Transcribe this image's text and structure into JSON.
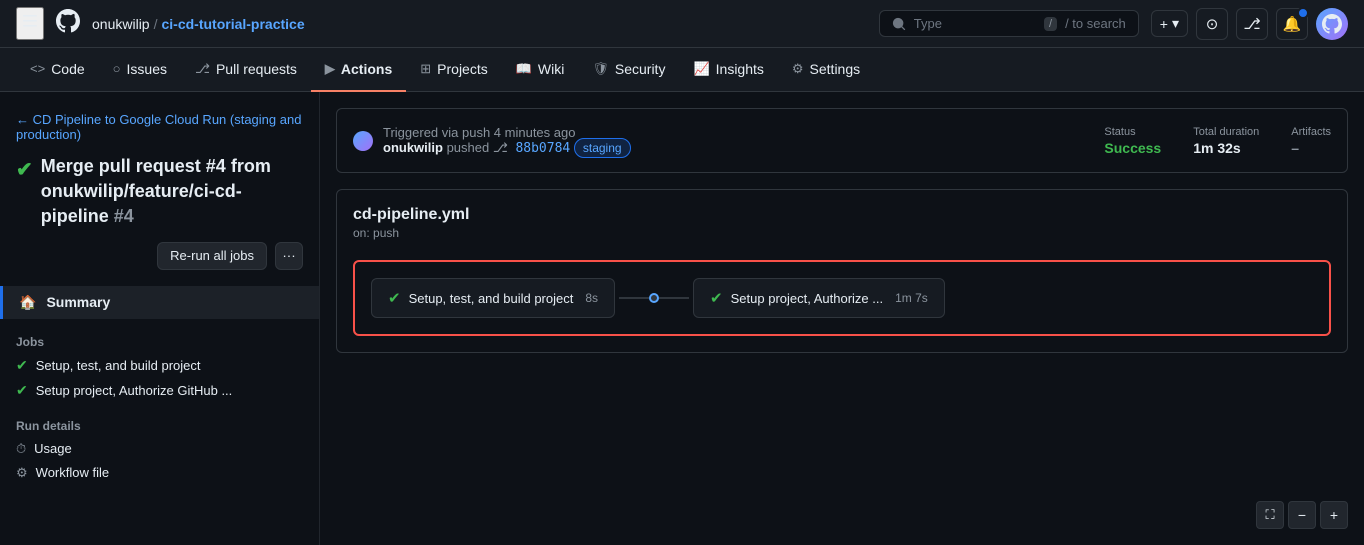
{
  "topbar": {
    "hamburger_label": "☰",
    "user": "onukwilip",
    "separator": "/",
    "repo": "ci-cd-tutorial-practice",
    "search_placeholder": "Type",
    "search_hint": "/ to search",
    "shortcut": "/",
    "plus_label": "+",
    "chevron_label": "▾"
  },
  "repo_nav": {
    "items": [
      {
        "id": "code",
        "icon": "<>",
        "label": "Code",
        "active": false
      },
      {
        "id": "issues",
        "icon": "○",
        "label": "Issues",
        "active": false
      },
      {
        "id": "pull-requests",
        "icon": "⎇",
        "label": "Pull requests",
        "active": false
      },
      {
        "id": "actions",
        "icon": "▶",
        "label": "Actions",
        "active": true
      },
      {
        "id": "projects",
        "icon": "⊞",
        "label": "Projects",
        "active": false
      },
      {
        "id": "wiki",
        "icon": "📖",
        "label": "Wiki",
        "active": false
      },
      {
        "id": "security",
        "icon": "🛡",
        "label": "Security",
        "active": false
      },
      {
        "id": "insights",
        "icon": "📈",
        "label": "Insights",
        "active": false
      },
      {
        "id": "settings",
        "icon": "⚙",
        "label": "Settings",
        "active": false
      }
    ]
  },
  "sidebar": {
    "back_label": "← CD Pipeline to Google Cloud Run (staging and production)",
    "run_title": "Merge pull request #4 from onukwilip/feature/ci-cd-pipeline",
    "run_number": "#4",
    "rerun_label": "Re-run all jobs",
    "more_label": "···",
    "summary_label": "Summary",
    "jobs_section": "Jobs",
    "jobs": [
      {
        "label": "Setup, test, and build project"
      },
      {
        "label": "Setup project, Authorize GitHub ..."
      }
    ],
    "run_details_section": "Run details",
    "run_details": [
      {
        "icon": "⏱",
        "label": "Usage"
      },
      {
        "icon": "⚙",
        "label": "Workflow file"
      }
    ]
  },
  "trigger_box": {
    "triggered_text": "Triggered via push 4 minutes ago",
    "user": "onukwilip",
    "pushed_text": "pushed",
    "commit": "88b0784",
    "branch": "staging",
    "status_label": "Status",
    "status_value": "Success",
    "duration_label": "Total duration",
    "duration_value": "1m 32s",
    "artifacts_label": "Artifacts",
    "artifacts_value": "–"
  },
  "workflow_box": {
    "filename": "cd-pipeline.yml",
    "trigger": "on: push"
  },
  "flow": {
    "node1_label": "Setup, test, and build project",
    "node1_time": "8s",
    "node2_label": "Setup project, Authorize ...",
    "node2_time": "1m 7s"
  },
  "bottom_controls": {
    "fullscreen_icon": "⛶",
    "zoom_out_icon": "−",
    "zoom_in_icon": "+"
  }
}
